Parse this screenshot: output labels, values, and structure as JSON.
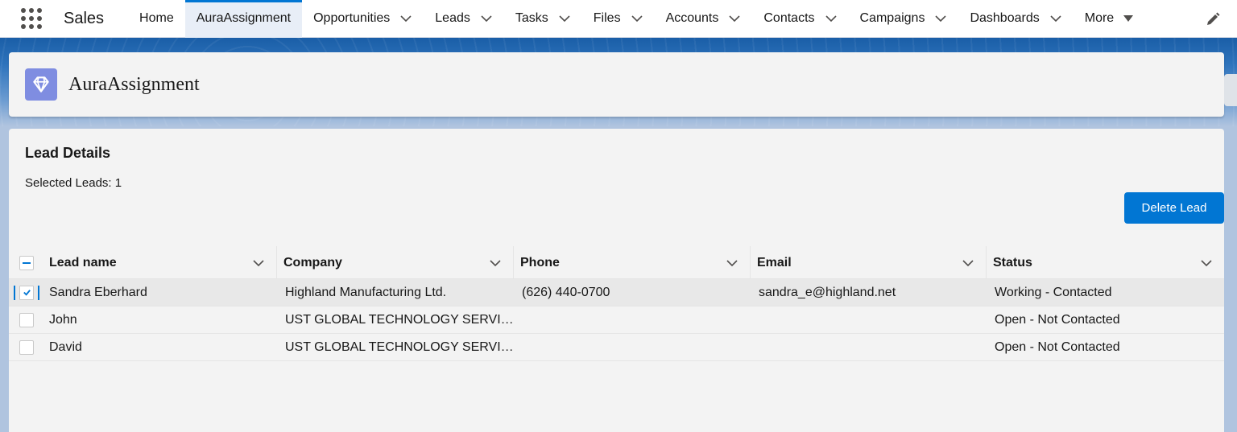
{
  "app": {
    "name": "Sales"
  },
  "nav": {
    "items": [
      {
        "label": "Home",
        "has_menu": false
      },
      {
        "label": "AuraAssignment",
        "has_menu": false,
        "active": true
      },
      {
        "label": "Opportunities",
        "has_menu": true
      },
      {
        "label": "Leads",
        "has_menu": true
      },
      {
        "label": "Tasks",
        "has_menu": true
      },
      {
        "label": "Files",
        "has_menu": true
      },
      {
        "label": "Accounts",
        "has_menu": true
      },
      {
        "label": "Contacts",
        "has_menu": true
      },
      {
        "label": "Campaigns",
        "has_menu": true
      },
      {
        "label": "Dashboards",
        "has_menu": true
      },
      {
        "label": "More",
        "has_menu": true
      }
    ],
    "edit_icon": "pencil-icon",
    "accent": "#0176d3"
  },
  "header": {
    "title": "AuraAssignment",
    "icon": "diamond-icon",
    "icon_color": "#7f8de1"
  },
  "card": {
    "title": "Lead Details",
    "selected_label": "Selected Leads: 1",
    "delete_label": "Delete Lead"
  },
  "table": {
    "columns": [
      "Lead name",
      "Company",
      "Phone",
      "Email",
      "Status"
    ],
    "select_all_state": "indeterminate",
    "rows": [
      {
        "selected": true,
        "name": "Sandra Eberhard",
        "company": "Highland Manufacturing Ltd.",
        "phone": "(626) 440-0700",
        "email": "sandra_e@highland.net",
        "status": "Working - Contacted"
      },
      {
        "selected": false,
        "name": "John",
        "company": "UST GLOBAL TECHNOLOGY SERVICES",
        "phone": "",
        "email": "",
        "status": "Open - Not Contacted"
      },
      {
        "selected": false,
        "name": "David",
        "company": "UST GLOBAL TECHNOLOGY SERVICES",
        "phone": "",
        "email": "",
        "status": "Open - Not Contacted"
      }
    ]
  }
}
